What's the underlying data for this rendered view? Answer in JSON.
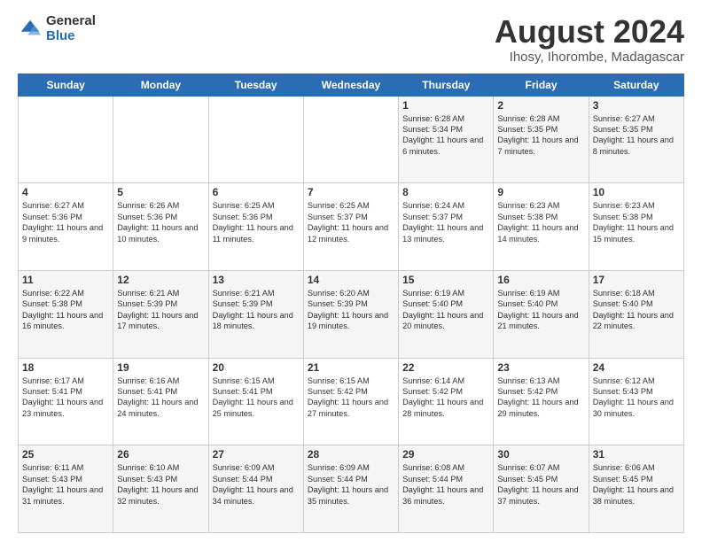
{
  "header": {
    "logo_general": "General",
    "logo_blue": "Blue",
    "title": "August 2024",
    "location": "Ihosy, Ihorombe, Madagascar"
  },
  "days_of_week": [
    "Sunday",
    "Monday",
    "Tuesday",
    "Wednesday",
    "Thursday",
    "Friday",
    "Saturday"
  ],
  "weeks": [
    [
      {
        "day": "",
        "info": ""
      },
      {
        "day": "",
        "info": ""
      },
      {
        "day": "",
        "info": ""
      },
      {
        "day": "",
        "info": ""
      },
      {
        "day": "1",
        "info": "Sunrise: 6:28 AM\nSunset: 5:34 PM\nDaylight: 11 hours and 6 minutes."
      },
      {
        "day": "2",
        "info": "Sunrise: 6:28 AM\nSunset: 5:35 PM\nDaylight: 11 hours and 7 minutes."
      },
      {
        "day": "3",
        "info": "Sunrise: 6:27 AM\nSunset: 5:35 PM\nDaylight: 11 hours and 8 minutes."
      }
    ],
    [
      {
        "day": "4",
        "info": "Sunrise: 6:27 AM\nSunset: 5:36 PM\nDaylight: 11 hours and 9 minutes."
      },
      {
        "day": "5",
        "info": "Sunrise: 6:26 AM\nSunset: 5:36 PM\nDaylight: 11 hours and 10 minutes."
      },
      {
        "day": "6",
        "info": "Sunrise: 6:25 AM\nSunset: 5:36 PM\nDaylight: 11 hours and 11 minutes."
      },
      {
        "day": "7",
        "info": "Sunrise: 6:25 AM\nSunset: 5:37 PM\nDaylight: 11 hours and 12 minutes."
      },
      {
        "day": "8",
        "info": "Sunrise: 6:24 AM\nSunset: 5:37 PM\nDaylight: 11 hours and 13 minutes."
      },
      {
        "day": "9",
        "info": "Sunrise: 6:23 AM\nSunset: 5:38 PM\nDaylight: 11 hours and 14 minutes."
      },
      {
        "day": "10",
        "info": "Sunrise: 6:23 AM\nSunset: 5:38 PM\nDaylight: 11 hours and 15 minutes."
      }
    ],
    [
      {
        "day": "11",
        "info": "Sunrise: 6:22 AM\nSunset: 5:38 PM\nDaylight: 11 hours and 16 minutes."
      },
      {
        "day": "12",
        "info": "Sunrise: 6:21 AM\nSunset: 5:39 PM\nDaylight: 11 hours and 17 minutes."
      },
      {
        "day": "13",
        "info": "Sunrise: 6:21 AM\nSunset: 5:39 PM\nDaylight: 11 hours and 18 minutes."
      },
      {
        "day": "14",
        "info": "Sunrise: 6:20 AM\nSunset: 5:39 PM\nDaylight: 11 hours and 19 minutes."
      },
      {
        "day": "15",
        "info": "Sunrise: 6:19 AM\nSunset: 5:40 PM\nDaylight: 11 hours and 20 minutes."
      },
      {
        "day": "16",
        "info": "Sunrise: 6:19 AM\nSunset: 5:40 PM\nDaylight: 11 hours and 21 minutes."
      },
      {
        "day": "17",
        "info": "Sunrise: 6:18 AM\nSunset: 5:40 PM\nDaylight: 11 hours and 22 minutes."
      }
    ],
    [
      {
        "day": "18",
        "info": "Sunrise: 6:17 AM\nSunset: 5:41 PM\nDaylight: 11 hours and 23 minutes."
      },
      {
        "day": "19",
        "info": "Sunrise: 6:16 AM\nSunset: 5:41 PM\nDaylight: 11 hours and 24 minutes."
      },
      {
        "day": "20",
        "info": "Sunrise: 6:15 AM\nSunset: 5:41 PM\nDaylight: 11 hours and 25 minutes."
      },
      {
        "day": "21",
        "info": "Sunrise: 6:15 AM\nSunset: 5:42 PM\nDaylight: 11 hours and 27 minutes."
      },
      {
        "day": "22",
        "info": "Sunrise: 6:14 AM\nSunset: 5:42 PM\nDaylight: 11 hours and 28 minutes."
      },
      {
        "day": "23",
        "info": "Sunrise: 6:13 AM\nSunset: 5:42 PM\nDaylight: 11 hours and 29 minutes."
      },
      {
        "day": "24",
        "info": "Sunrise: 6:12 AM\nSunset: 5:43 PM\nDaylight: 11 hours and 30 minutes."
      }
    ],
    [
      {
        "day": "25",
        "info": "Sunrise: 6:11 AM\nSunset: 5:43 PM\nDaylight: 11 hours and 31 minutes."
      },
      {
        "day": "26",
        "info": "Sunrise: 6:10 AM\nSunset: 5:43 PM\nDaylight: 11 hours and 32 minutes."
      },
      {
        "day": "27",
        "info": "Sunrise: 6:09 AM\nSunset: 5:44 PM\nDaylight: 11 hours and 34 minutes."
      },
      {
        "day": "28",
        "info": "Sunrise: 6:09 AM\nSunset: 5:44 PM\nDaylight: 11 hours and 35 minutes."
      },
      {
        "day": "29",
        "info": "Sunrise: 6:08 AM\nSunset: 5:44 PM\nDaylight: 11 hours and 36 minutes."
      },
      {
        "day": "30",
        "info": "Sunrise: 6:07 AM\nSunset: 5:45 PM\nDaylight: 11 hours and 37 minutes."
      },
      {
        "day": "31",
        "info": "Sunrise: 6:06 AM\nSunset: 5:45 PM\nDaylight: 11 hours and 38 minutes."
      }
    ]
  ]
}
